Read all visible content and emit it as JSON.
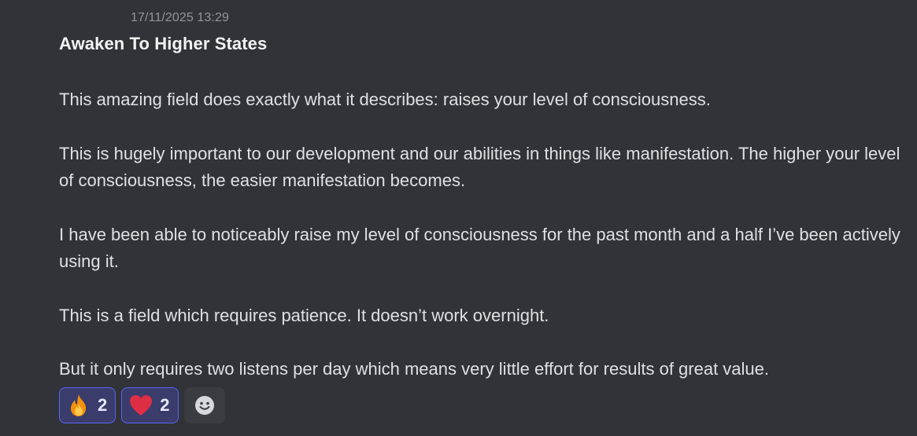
{
  "message": {
    "timestamp": "17/11/2025 13:29",
    "title": "Awaken To Higher States",
    "paragraphs": [
      "This amazing field does exactly what it describes: raises your level of consciousness.",
      "This is hugely important to our development and our abilities in things like manifestation. The higher your level of consciousness, the easier manifestation becomes.",
      "I have been able to noticeably raise my level of consciousness for the past month and a half I’ve been actively using it.",
      "This is a field which requires patience. It doesn’t work overnight.",
      "But it only requires two listens per day which means very little effort for results of great value."
    ]
  },
  "reactions": [
    {
      "icon": "fire-icon",
      "count": "2"
    },
    {
      "icon": "heart-icon",
      "count": "2"
    }
  ],
  "add_reaction": {
    "icon": "smiley-add-reaction-icon"
  },
  "colors": {
    "background": "#323339",
    "reaction_bg": "#3a3c6c",
    "reaction_border": "#5865f2",
    "timestamp": "#94959c"
  }
}
